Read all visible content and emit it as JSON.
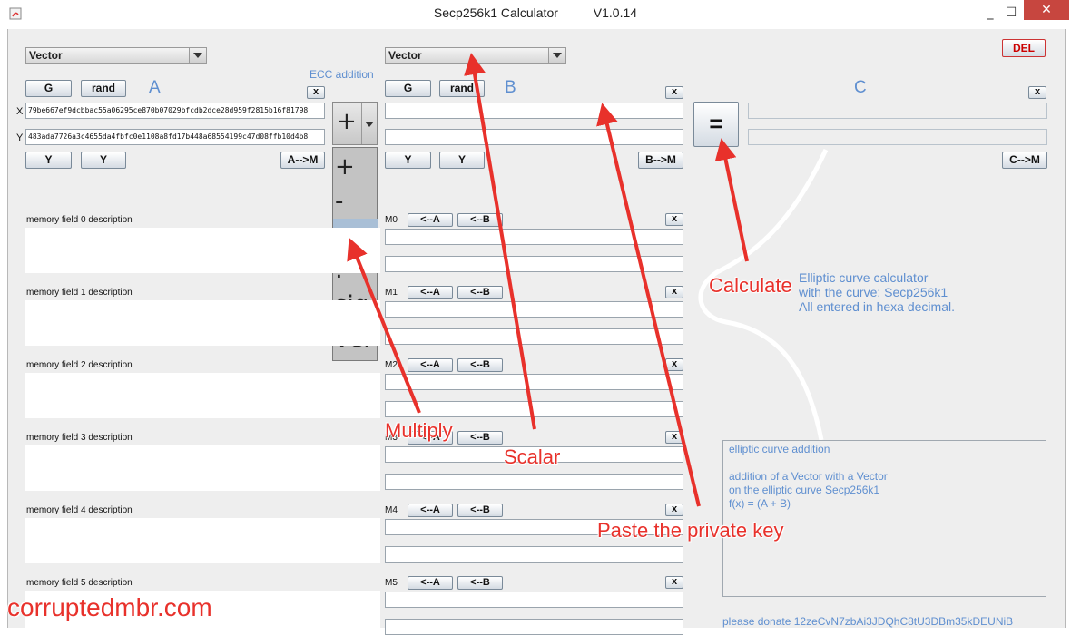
{
  "window": {
    "title": "Secp256k1 Calculator          V1.0.14",
    "minimize": "_",
    "maximize": "☐",
    "close": "✕",
    "del_label": "DEL"
  },
  "panel_a": {
    "mode": "Vector",
    "g_label": "G",
    "rand_label": "rand",
    "header": "A",
    "clear": "x",
    "x_axis": "X",
    "y_axis": "Y",
    "x_value": "79be667ef9dcbbac55a06295ce870b07029bfcdb2dce28d959f2815b16f81798",
    "y_value": "483ada7726a3c4655da4fbfc0e1108a8fd17b448a68554199c47d08ffb10d4b8",
    "y_btn1": "Y",
    "y_btn2": "Y",
    "to_memory": "A-->M"
  },
  "operator": {
    "hint": "ECC addition",
    "selected": "+",
    "options": [
      "+",
      "-",
      "•",
      ":",
      "sig",
      "ver"
    ]
  },
  "panel_b": {
    "mode": "Vector",
    "g_label": "G",
    "rand_label": "rand",
    "header": "B",
    "clear": "x",
    "y_btn1": "Y",
    "y_btn2": "Y",
    "to_memory": "B-->M"
  },
  "panel_c": {
    "header": "C",
    "clear": "x",
    "equals": "=",
    "to_memory": "C-->M",
    "info_lines": [
      "Elliptic curve calculator",
      "with the curve: Secp256k1",
      "All entered in hexa decimal."
    ],
    "desc_lines": [
      "elliptic curve addition",
      "",
      "addition of a Vector with a Vector",
      "on the elliptic curve Secp256k1",
      "f(x) = (A + B)"
    ],
    "donate": "please donate  12zeCvN7zbAi3JDQhC8tU3DBm35kDEUNiB"
  },
  "memory": [
    {
      "desc": "memory field 0  description",
      "label": "M0",
      "to_a": "<--A",
      "to_b": "<--B",
      "clear": "x"
    },
    {
      "desc": "memory field 1  description",
      "label": "M1",
      "to_a": "<--A",
      "to_b": "<--B",
      "clear": "x"
    },
    {
      "desc": "memory field 2  description",
      "label": "M2",
      "to_a": "<--A",
      "to_b": "<--B",
      "clear": "x"
    },
    {
      "desc": "memory field 3  description",
      "label": "M3",
      "to_a": "<--A",
      "to_b": "<--B",
      "clear": "x"
    },
    {
      "desc": "memory field 4  description",
      "label": "M4",
      "to_a": "<--A",
      "to_b": "<--B",
      "clear": "x"
    },
    {
      "desc": "memory field 5  description",
      "label": "M5",
      "to_a": "<--A",
      "to_b": "<--B",
      "clear": "x"
    }
  ],
  "annotations": {
    "calculate": "Calculate",
    "multiply": "Multiply",
    "scalar": "Scalar",
    "paste": "Paste the private key"
  },
  "watermark": "corruptedmbr.com",
  "colors": {
    "arrow": "#e8312b",
    "info_text": "#5f8fd0",
    "close_button": "#c7463f"
  }
}
